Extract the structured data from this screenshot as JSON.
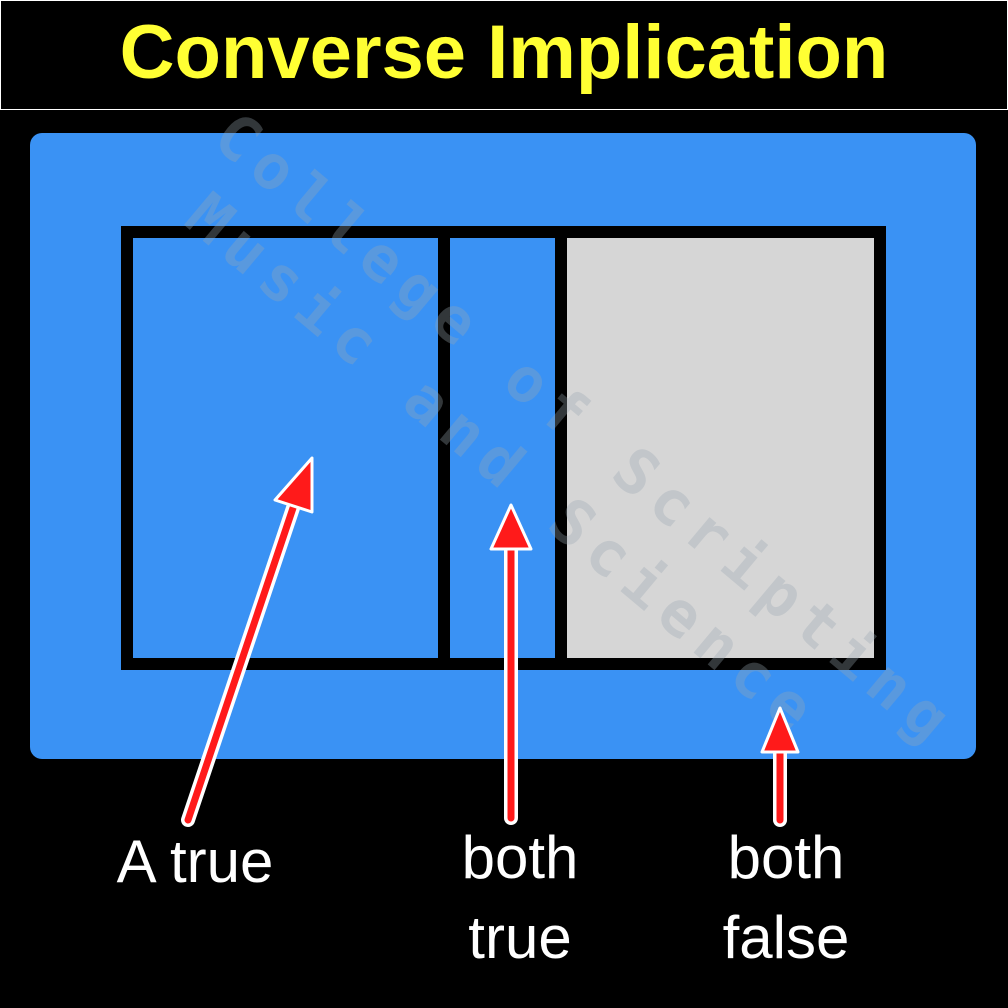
{
  "title": "Converse Implication",
  "watermark": {
    "line1": "College of Scripting",
    "line2": "Music and Science"
  },
  "labels": {
    "a_true": "A true",
    "both_true_line1": "both",
    "both_true_line2": "true",
    "both_false_line1": "both",
    "both_false_line2": "false"
  },
  "colors": {
    "background": "#000000",
    "title_text": "#ffff33",
    "universe_fill": "#3a92f4",
    "region_false_fill": "#d6d6d6",
    "border": "#000000",
    "arrow_fill": "#ff1a1a",
    "arrow_outline": "#ffffff",
    "label_text": "#ffffff"
  }
}
